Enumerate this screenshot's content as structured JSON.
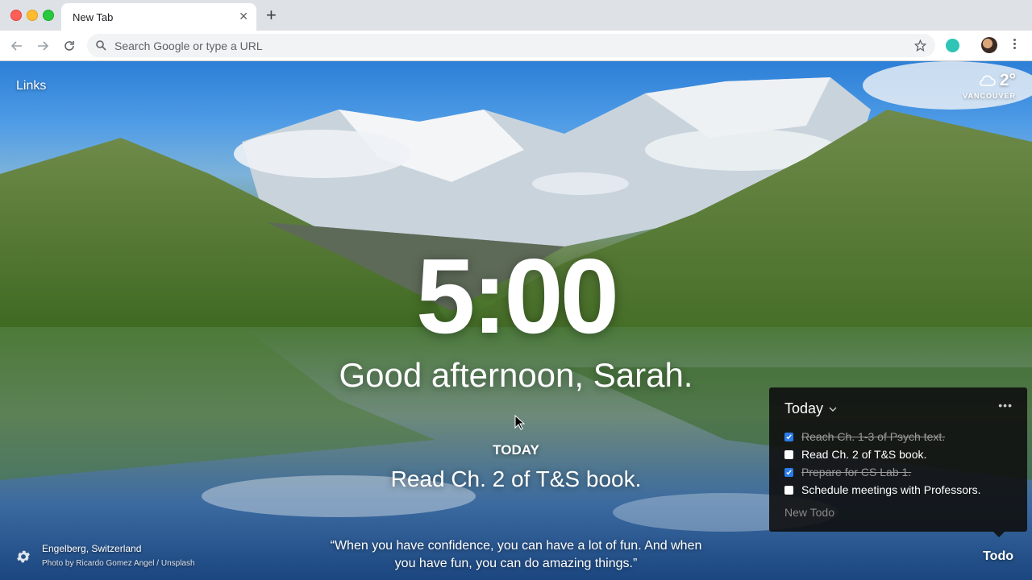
{
  "browser": {
    "tab_title": "New Tab",
    "omnibox_placeholder": "Search Google or type a URL"
  },
  "page": {
    "links_label": "Links",
    "weather": {
      "temperature": "2°",
      "location": "VANCOUVER",
      "icon": "cloud-icon"
    },
    "clock": "5:00",
    "greeting": "Good afternoon, Sarah.",
    "focus": {
      "label": "TODAY",
      "text": "Read Ch. 2 of T&S book."
    },
    "quote": "“When you have confidence, you can have a lot of fun. And when you have fun, you can do amazing things.”",
    "photo": {
      "location": "Engelberg, Switzerland",
      "credit": "Photo by Ricardo Gomez Angel / Unsplash"
    },
    "todo_toggle": "Todo"
  },
  "todo": {
    "list_title": "Today",
    "more_label": "•••",
    "items": [
      {
        "text": "Reach Ch. 1-3 of Psych text.",
        "done": true
      },
      {
        "text": "Read Ch. 2 of T&S book.",
        "done": false
      },
      {
        "text": "Prepare for CS Lab 1.",
        "done": true
      },
      {
        "text": "Schedule meetings with Professors.",
        "done": false
      }
    ],
    "new_placeholder": "New Todo"
  },
  "colors": {
    "accent_checkbox": "#2b7ce9",
    "extension": "#2ec4b6"
  }
}
